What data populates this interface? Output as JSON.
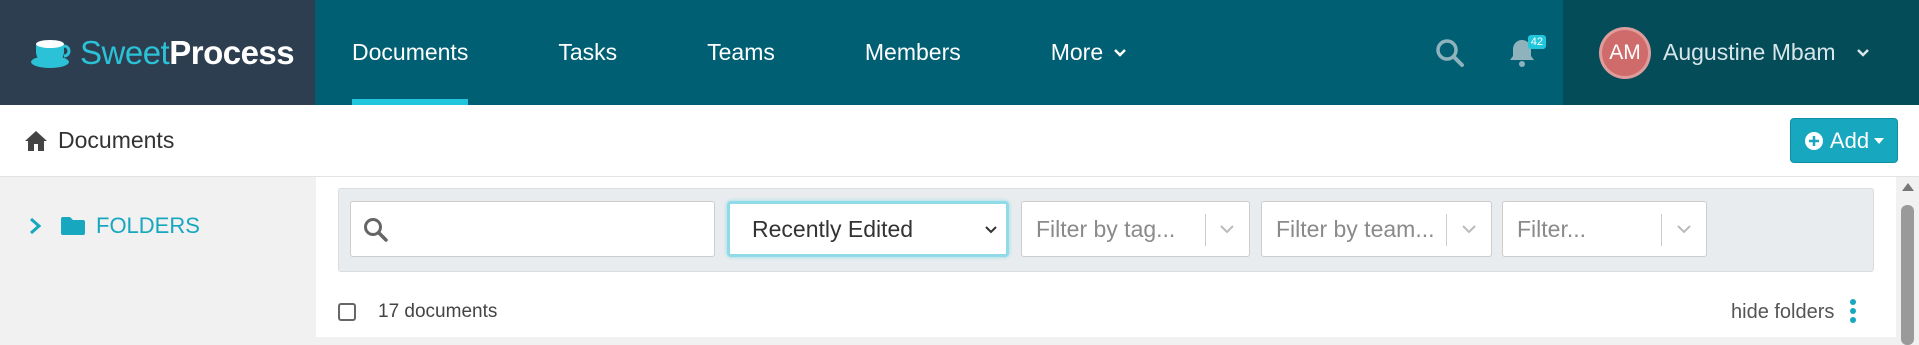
{
  "brand": {
    "sweet": "Sweet",
    "process": "Process",
    "icon": "coffee-cup-logo"
  },
  "nav": {
    "items": [
      {
        "label": "Documents",
        "active": true
      },
      {
        "label": "Tasks",
        "active": false
      },
      {
        "label": "Teams",
        "active": false
      },
      {
        "label": "Members",
        "active": false
      },
      {
        "label": "More",
        "active": false,
        "has_dropdown": true
      }
    ],
    "search_icon": "search-icon",
    "notifications": {
      "icon": "bell-icon",
      "count": "42"
    }
  },
  "user": {
    "initials": "AM",
    "name": "Augustine Mbam",
    "avatar_color": "#d06b6b"
  },
  "subheader": {
    "breadcrumb": "Documents",
    "breadcrumb_icon": "home-icon",
    "add_label": "Add"
  },
  "sidebar": {
    "folders_label": "FOLDERS"
  },
  "filters": {
    "search_placeholder": "",
    "sort_value": "Recently Edited",
    "tag_placeholder": "Filter by tag...",
    "team_placeholder": "Filter by team...",
    "other_placeholder": "Filter..."
  },
  "list": {
    "count_label": "17 documents",
    "hide_folders_label": "hide folders"
  },
  "colors": {
    "nav_bg": "#005f73",
    "brand_bg": "#2c3e50",
    "accent": "#17a7be",
    "user_bg": "#054c59"
  }
}
